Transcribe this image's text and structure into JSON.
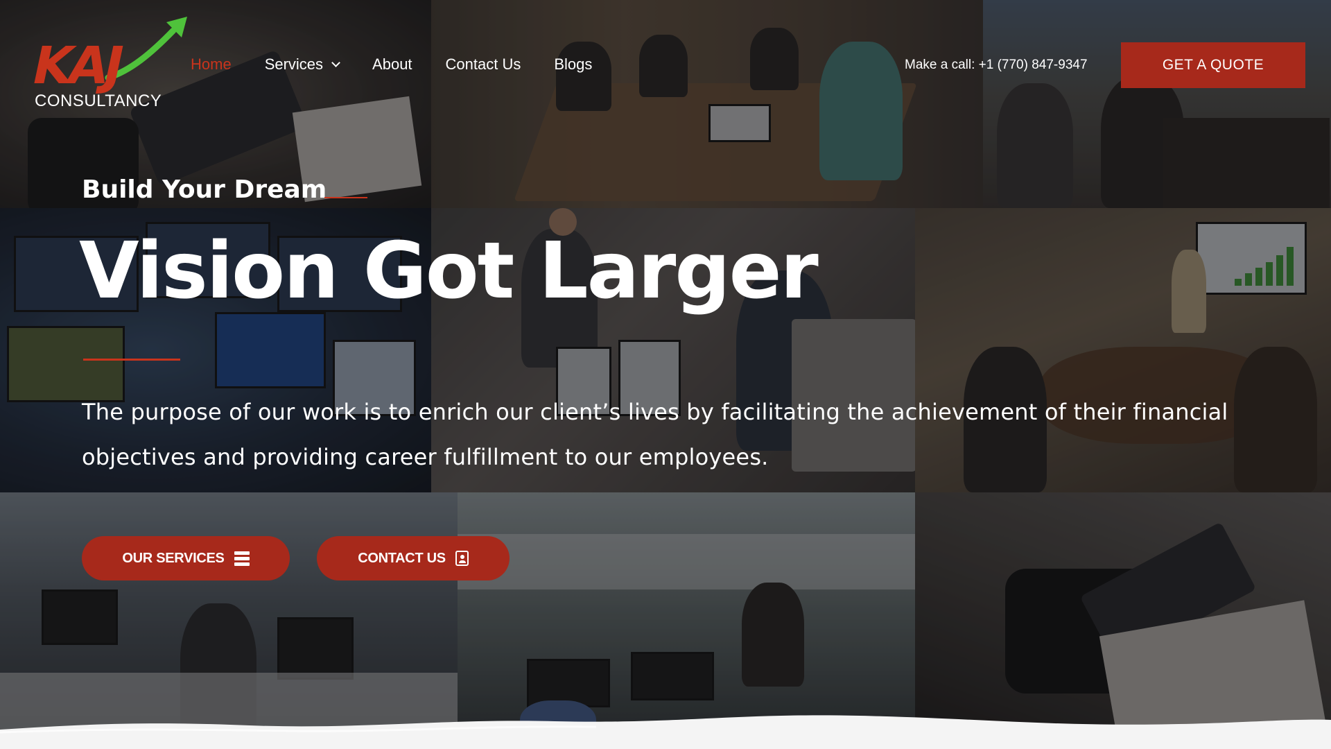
{
  "brand": {
    "logo_text": "KAJ",
    "logo_sub": "CONSULTANCY",
    "accent": "#a7291b",
    "accent_text": "#c9341c",
    "arrow_color": "#4fc23b"
  },
  "nav": {
    "items": [
      {
        "label": "Home",
        "active": true
      },
      {
        "label": "Services",
        "dropdown": true
      },
      {
        "label": "About"
      },
      {
        "label": "Contact Us"
      },
      {
        "label": "Blogs"
      }
    ]
  },
  "header": {
    "call_text": "Make a call: +1 (770) 847-9347",
    "quote_button": "GET A QUOTE"
  },
  "hero": {
    "eyebrow": "Build Your Dream",
    "headline": "Vision Got Larger",
    "lead": "The purpose of our work is to enrich our client’s lives by facilitating the achievement of their financial objectives and providing career fulfillment to our employees.",
    "services_button": "OUR SERVICES",
    "contact_button": "CONTACT US"
  },
  "icons": {
    "services": "list-icon",
    "contact": "contact-card-icon",
    "dropdown": "chevron-down-icon"
  }
}
